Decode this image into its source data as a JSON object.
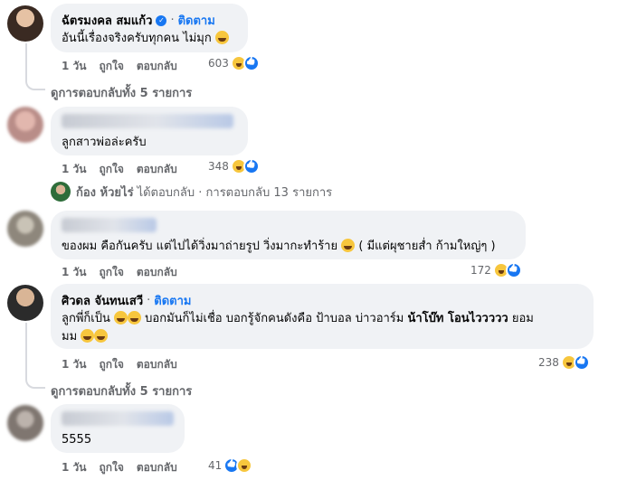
{
  "comments": [
    {
      "author": "ฉัตรมงคล สมแก้ว",
      "verified": true,
      "follow_label": "ติดตาม",
      "text": "อันนี้เรื่องจริงครับทุกคน ไม่มุก",
      "time": "1 วัน",
      "like": "ถูกใจ",
      "reply": "ตอบกลับ",
      "reaction_count": "603",
      "reaction_icons": [
        "haha-icon",
        "like-icon"
      ],
      "replies_label": "ดูการตอบกลับทั้ง 5 รายการ"
    },
    {
      "author": "",
      "text": "ลูกสาวพ่อล่ะครับ",
      "time": "1 วัน",
      "like": "ถูกใจ",
      "reply": "ตอบกลับ",
      "reaction_count": "348",
      "reaction_icons": [
        "haha-icon",
        "like-icon"
      ],
      "replied_by": "ก้อง ห้วยไร่",
      "replied_text": "ได้ตอบกลับ · การตอบกลับ 13 รายการ"
    },
    {
      "author": "",
      "text": "ของผม คือกันครับ แต่ไปได้วิ่งมาถ่ายรูป วิ่งมากะทำร้าย",
      "text_after": " ( มีแต่ผุชายส่ำ ก้ามใหญ่ๆ )",
      "time": "1 วัน",
      "like": "ถูกใจ",
      "reply": "ตอบกลับ",
      "reaction_count": "172",
      "reaction_icons": [
        "haha-icon",
        "like-icon"
      ]
    },
    {
      "author": "ศิวดล จันทนเสวี",
      "follow_label": "ติดตาม",
      "line1_a": "ลูกพี่ก็เป็น",
      "line1_b": " บอกมันก็ไม่เชื่อ บอกรู้จักคนดังคือ ป้าบอล บ่าวอาร์ม ",
      "line1_bold": "น้าโบ๊ท โอนไววววว",
      "line1_c": " ยอม",
      "line2": "มม",
      "time": "1 วัน",
      "like": "ถูกใจ",
      "reply": "ตอบกลับ",
      "reaction_count": "238",
      "reaction_icons": [
        "haha-icon",
        "like-icon"
      ],
      "replies_label": "ดูการตอบกลับทั้ง 5 รายการ"
    },
    {
      "author": "",
      "text": "5555",
      "time": "1 วัน",
      "like": "ถูกใจ",
      "reply": "ตอบกลับ",
      "reaction_count": "41",
      "reaction_icons": [
        "like-icon",
        "haha-icon"
      ]
    }
  ]
}
